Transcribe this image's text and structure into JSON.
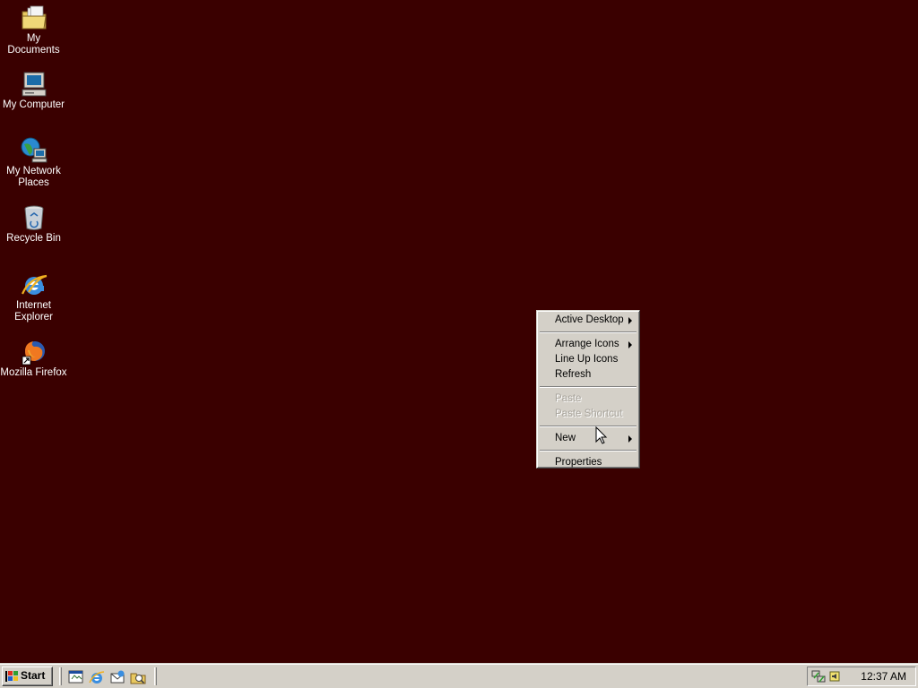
{
  "desktop": {
    "background_color": "#3a0000",
    "icons": [
      {
        "label": "My Documents",
        "icon": "folder-documents-icon"
      },
      {
        "label": "My Computer",
        "icon": "computer-icon"
      },
      {
        "label": "My Network Places",
        "icon": "network-places-icon"
      },
      {
        "label": "Recycle Bin",
        "icon": "recycle-bin-icon"
      },
      {
        "label": "Internet Explorer",
        "icon": "internet-explorer-icon"
      },
      {
        "label": "Mozilla Firefox",
        "icon": "firefox-icon"
      }
    ]
  },
  "context_menu": {
    "items": [
      {
        "label": "Active Desktop",
        "submenu": true,
        "disabled": false
      },
      {
        "label": "Arrange Icons",
        "submenu": true,
        "disabled": false
      },
      {
        "label": "Line Up Icons",
        "submenu": false,
        "disabled": false
      },
      {
        "label": "Refresh",
        "submenu": false,
        "disabled": false
      },
      {
        "label": "Paste",
        "submenu": false,
        "disabled": true
      },
      {
        "label": "Paste Shortcut",
        "submenu": false,
        "disabled": true
      },
      {
        "label": "New",
        "submenu": true,
        "disabled": false
      },
      {
        "label": "Properties",
        "submenu": false,
        "disabled": false
      }
    ]
  },
  "taskbar": {
    "start_label": "Start",
    "quick_launch": [
      "show-desktop-icon",
      "internet-explorer-icon",
      "outlook-express-icon",
      "explorer-icon"
    ],
    "tray_icons": [
      "network-icon",
      "volume-icon"
    ],
    "clock": "12:37 AM"
  }
}
